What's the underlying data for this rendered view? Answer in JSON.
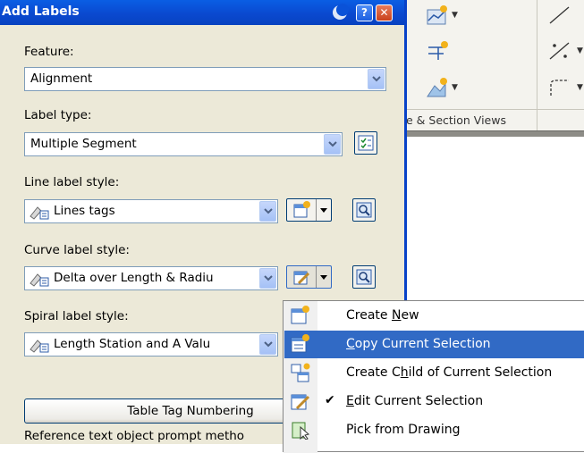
{
  "dialog": {
    "title": "Add Labels",
    "feature": {
      "label": "Feature:",
      "value": "Alignment"
    },
    "label_type": {
      "label": "Label type:",
      "value": "Multiple Segment"
    },
    "line_label_style": {
      "label": "Line label style:",
      "value": "Lines tags"
    },
    "curve_label_style": {
      "label": "Curve label style:",
      "value": "Delta over Length & Radiu"
    },
    "spiral_label_style": {
      "label": "Spiral label style:",
      "value": "Length Station and A Valu"
    },
    "table_tag_button": "Table Tag Numbering",
    "reference_text": "Reference text object prompt metho"
  },
  "ribbon": {
    "panel_title": "e & Section Views"
  },
  "context_menu": {
    "items": [
      {
        "pre": "Create ",
        "u": "N",
        "post": "ew",
        "icon": "create-new-icon",
        "checked": false,
        "highlighted": false
      },
      {
        "pre": "",
        "u": "C",
        "post": "opy Current Selection",
        "icon": "copy-selection-icon",
        "checked": false,
        "highlighted": true
      },
      {
        "pre": "Create C",
        "u": "h",
        "post": "ild of Current Selection",
        "icon": "create-child-icon",
        "checked": false,
        "highlighted": false
      },
      {
        "pre": "",
        "u": "E",
        "post": "dit Current Selection",
        "icon": "edit-selection-icon",
        "checked": true,
        "highlighted": false
      },
      {
        "pre": "Pick from Drawing",
        "u": "",
        "post": "",
        "icon": "pick-drawing-icon",
        "checked": false,
        "highlighted": false
      }
    ]
  },
  "colors": {
    "title_bar": "#0a52d8",
    "dialog_bg": "#ece9d8",
    "menu_highlight": "#316ac5"
  }
}
